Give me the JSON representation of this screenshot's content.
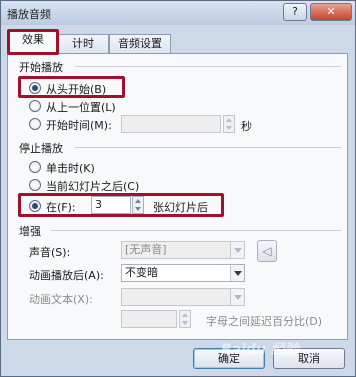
{
  "window": {
    "title": "播放音频",
    "help_label": "?",
    "close_label": "✕"
  },
  "tabs": [
    {
      "label": "效果",
      "active": true
    },
    {
      "label": "计时",
      "active": false
    },
    {
      "label": "音频设置",
      "active": false
    }
  ],
  "start": {
    "section_title": "开始播放",
    "from_beginning": "从头开始(B)",
    "from_last_position": "从上一位置(L)",
    "start_time_label": "开始时间(M):",
    "start_time_value": "",
    "seconds_unit": "秒"
  },
  "stop": {
    "section_title": "停止播放",
    "on_click": "单击时(K)",
    "after_current_slide": "当前幻灯片之后(C)",
    "after_label": "在(F):",
    "after_value": "3",
    "after_unit": "张幻灯片后"
  },
  "enhance": {
    "section_title": "增强",
    "sound_label": "声音(S):",
    "sound_value": "[无声音]",
    "after_animation_label": "动画播放后(A):",
    "after_animation_value": "不变暗",
    "animate_text_label": "动画文本(X):",
    "animate_text_value": "",
    "letter_delay_value": "",
    "letter_delay_unit": "字母之间延迟百分比(D)"
  },
  "buttons": {
    "ok": "确定",
    "cancel": "取消"
  },
  "watermark": "Baidu 经验",
  "colors": {
    "highlight_box": "#a2102c",
    "accent": "#3c7fb1"
  }
}
